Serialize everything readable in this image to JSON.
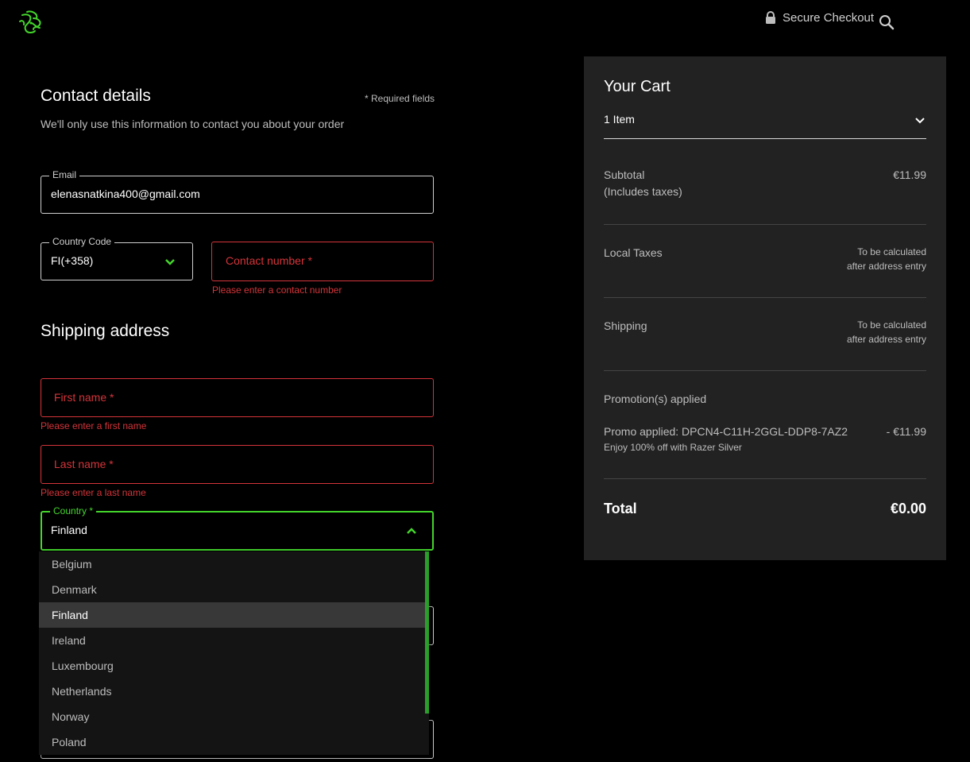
{
  "header": {
    "secure_label": "Secure Checkout",
    "brand_color": "#44d62c"
  },
  "contact": {
    "title": "Contact details",
    "required_note": "* Required fields",
    "subtitle": "We'll only use this information to contact you about your order",
    "email_label": "Email",
    "email_value": "elenasnatkina400@gmail.com",
    "country_code_label": "Country Code",
    "country_code_value": "FI(+358)",
    "contact_placeholder": "Contact number *",
    "contact_error": "Please enter a contact number"
  },
  "shipping": {
    "title": "Shipping address",
    "first_name_placeholder": "First name *",
    "first_name_error": "Please enter a first name",
    "last_name_placeholder": "Last name *",
    "last_name_error": "Please enter a last name",
    "country_label": "Country *",
    "country_value": "Finland",
    "country_options": [
      "Belgium",
      "Denmark",
      "Finland",
      "Ireland",
      "Luxembourg",
      "Netherlands",
      "Norway",
      "Poland"
    ],
    "selected_country": "Finland"
  },
  "cart": {
    "title": "Your Cart",
    "items_label": "1 Item",
    "subtotal_label": "Subtotal",
    "subtotal_note": "(Includes taxes)",
    "subtotal_value": "€11.99",
    "local_taxes_label": "Local Taxes",
    "local_taxes_value_1": "To be calculated",
    "local_taxes_value_2": "after address entry",
    "shipping_label": "Shipping",
    "shipping_value_1": "To be calculated",
    "shipping_value_2": "after address entry",
    "promotions_label": "Promotion(s) applied",
    "promo_label": "Promo applied: DPCN4-C11H-2GGL-DDP8-7AZ2",
    "promo_value": "- €11.99",
    "promo_note": "Enjoy 100% off with Razer Silver",
    "total_label": "Total",
    "total_value": "€0.00"
  }
}
